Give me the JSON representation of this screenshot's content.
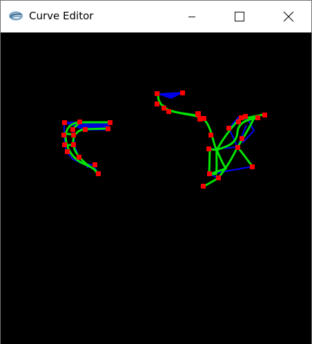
{
  "window": {
    "title": "Curve Editor"
  },
  "icons": {
    "app": "curve-editor-app-icon",
    "minimize": "minimize-icon",
    "maximize": "maximize-icon",
    "close": "close-icon"
  },
  "colors": {
    "canvas_background": "#000000",
    "curve": "#00e600",
    "control_polygon": "#0000ff",
    "control_point": "#ff0000"
  }
}
